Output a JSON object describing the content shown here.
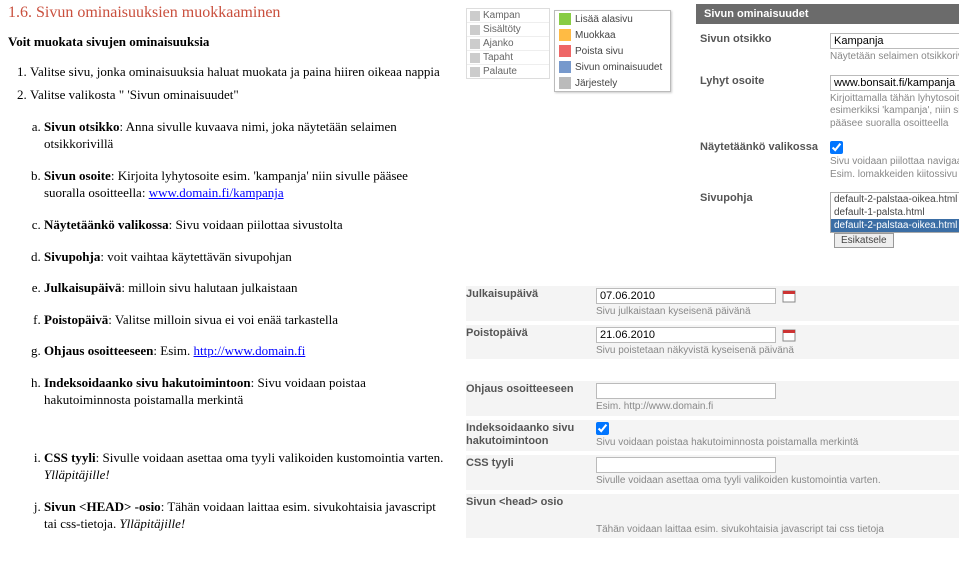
{
  "section_title": "1.6. Sivun ominaisuuksien muokkaaminen",
  "intro": "Voit muokata sivujen ominaisuuksia",
  "steps": [
    "Valitse sivu, jonka ominaisuuksia haluat muokata ja paina hiiren oikeaa nappia",
    "Valitse valikosta \" 'Sivun ominaisuudet\""
  ],
  "details": [
    {
      "key": "a",
      "bold": "Sivun otsikko",
      "text": ": Anna sivulle kuvaava nimi, joka näytetään selaimen otsikkorivillä"
    },
    {
      "key": "b",
      "bold": "Sivun osoite",
      "text": ": Kirjoita lyhytosoite esim. 'kampanja' niin sivulle pääsee suoralla osoitteella: ",
      "link_text": "www.domain.fi/kampanja"
    },
    {
      "key": "c",
      "bold": "Näytetäänkö valikossa",
      "text": ": Sivu voidaan piilottaa sivustolta"
    },
    {
      "key": "d",
      "bold": "Sivupohja",
      "text": ": voit vaihtaa käytettävän sivupohjan"
    },
    {
      "key": "e",
      "bold": "Julkaisupäivä",
      "text": ": milloin sivu halutaan julkaistaan"
    },
    {
      "key": "f",
      "bold": "Poistopäivä",
      "text": ": Valitse milloin sivua ei voi enää tarkastella"
    },
    {
      "key": "g",
      "bold": "Ohjaus osoitteeseen",
      "text": ": Esim. ",
      "link_text": "http://www.domain.fi"
    },
    {
      "key": "h",
      "bold": "Indeksoidaanko sivu hakutoimintoon",
      "text": ": Sivu voidaan poistaa hakutoiminnosta poistamalla merkintä"
    },
    {
      "key": "i",
      "bold": "CSS tyyli",
      "text": ": Sivulle voidaan asettaa oma tyyli valikoiden kustomointia varten. ",
      "ital": "Ylläpitäjille!"
    },
    {
      "key": "j",
      "bold": "Sivun <HEAD> -osio",
      "text": ": Tähän voidaan laittaa esim. sivukohtaisia javascript tai css-tietoja. ",
      "ital": "Ylläpitäjille!"
    }
  ],
  "tree_items": [
    "Kampan",
    "Sisältöty",
    "Ajanko",
    "Tapaht",
    "Palaute"
  ],
  "ctx_menu": {
    "add": "Lisää alasivu",
    "edit": "Muokkaa",
    "del": "Poista sivu",
    "prop": "Sivun ominaisuudet",
    "sort": "Järjestely"
  },
  "panel": {
    "header1": "Sivun ominaisuudet",
    "otsikko_label": "Sivun otsikko",
    "otsikko_value": "Kampanja",
    "otsikko_hint": "Näytetään selaimen otsikkorivillä",
    "osoite_label": "Lyhyt osoite",
    "osoite_value": "www.bonsait.fi/kampanja",
    "osoite_hint": "Kirjoittamalla tähän lyhytosoitteen esimerkiksi 'kampanja', niin sivulle pääsee suoralla osoitteella",
    "nayt_label": "Näytetäänkö valikossa",
    "nayt_hint": "Sivu voidaan piilottaa navigaatiosta. Esim. lomakkeiden kiitossivu",
    "pohja_label": "Sivupohja",
    "pohja_options": [
      "default-2-palstaa-oikea.html",
      "default-1-palsta.html",
      "default-2-palstaa-oikea.html"
    ],
    "preview_btn": "Esikatsele",
    "julk_label": "Julkaisupäivä",
    "julk_value": "07.06.2010",
    "julk_hint": "Sivu julkaistaan kyseisenä päivänä",
    "poisto_label": "Poistopäivä",
    "poisto_value": "21.06.2010",
    "poisto_hint": "Sivu poistetaan näkyvistä kyseisenä päivänä",
    "ohj_label": "Ohjaus osoitteeseen",
    "ohj_hint": "Esim. http://www.domain.fi",
    "idx_label": "Indeksoidaanko sivu hakutoimintoon",
    "idx_hint": "Sivu voidaan poistaa hakutoiminnosta poistamalla merkintä",
    "css_label": "CSS tyyli",
    "css_hint": "Sivulle voidaan asettaa oma tyyli valikoiden kustomointia varten.",
    "head_label": "Sivun <head> osio",
    "head_hint": "Tähän voidaan laittaa esim. sivukohtaisia javascript tai css tietoja"
  }
}
